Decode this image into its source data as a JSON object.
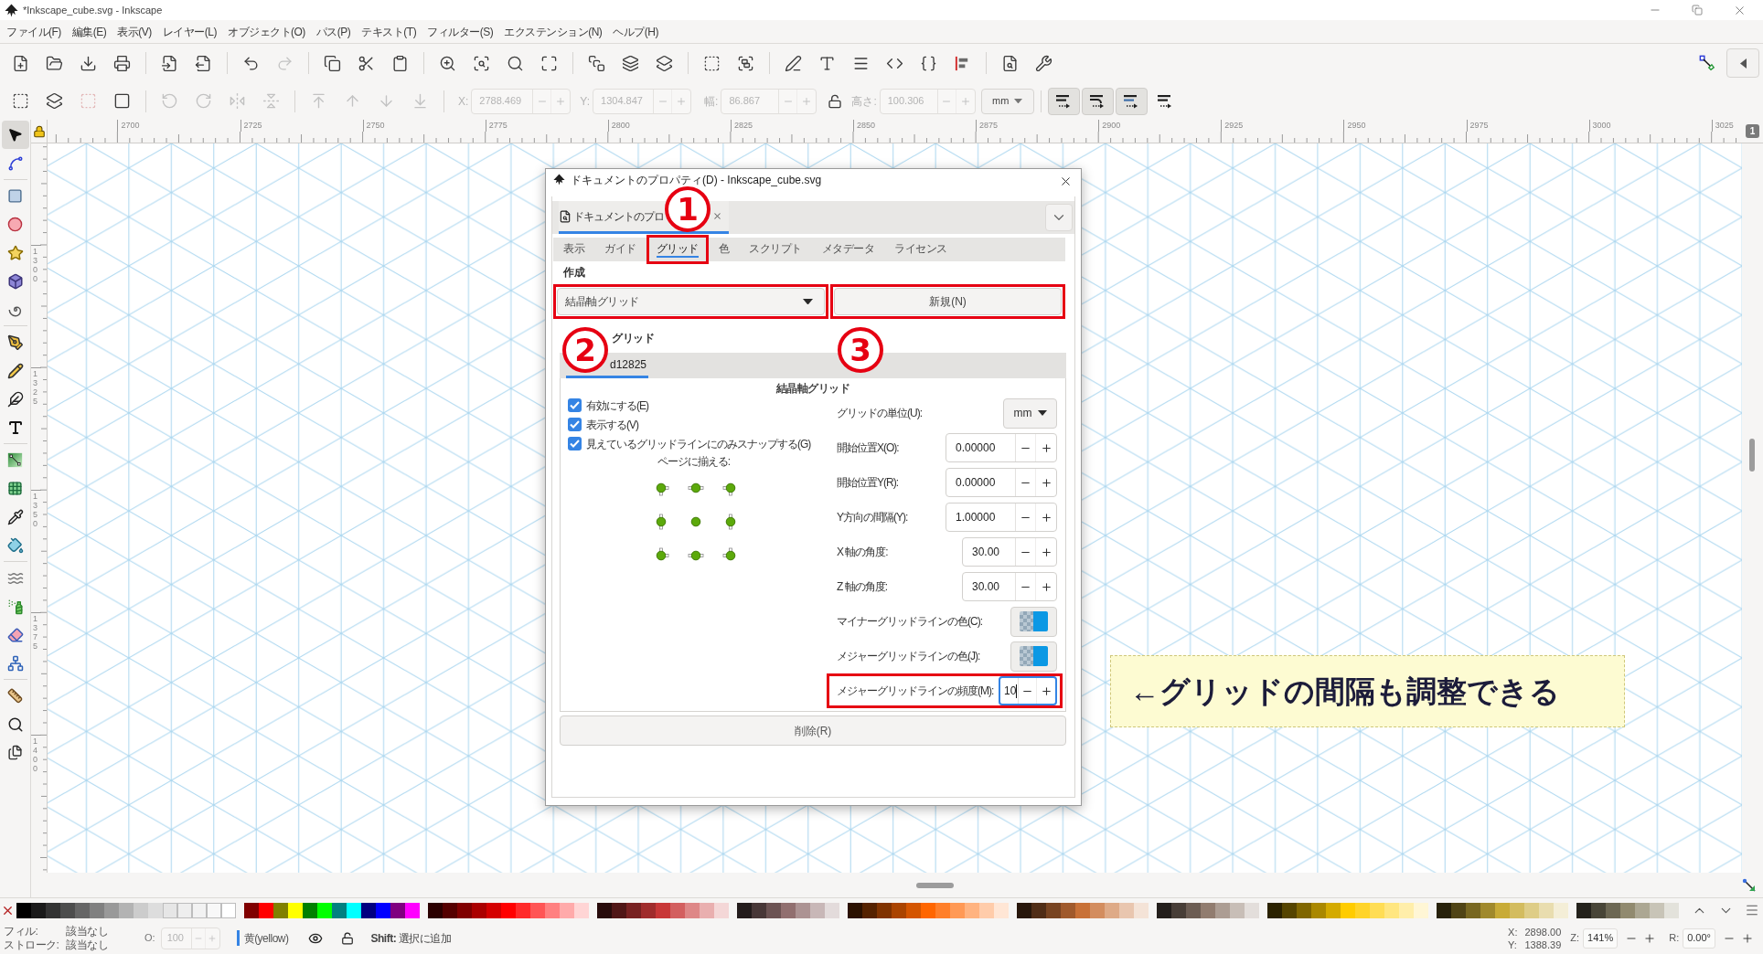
{
  "window": {
    "title": "*Inkscape_cube.svg - Inkscape"
  },
  "menu": [
    "ファイル(F)",
    "編集(E)",
    "表示(V)",
    "レイヤー(L)",
    "オブジェクト(O)",
    "パス(P)",
    "テキスト(T)",
    "フィルター(S)",
    "エクステンション(N)",
    "ヘルプ(H)"
  ],
  "toolbar": {
    "fields": [
      {
        "label": "X:",
        "value": "2788.469",
        "disabled": true
      },
      {
        "label": "Y:",
        "value": "1304.847",
        "disabled": true
      },
      {
        "label": "幅:",
        "value": "86.867",
        "disabled": true
      },
      {
        "label": "高さ:",
        "value": "100.306",
        "disabled": true
      }
    ],
    "unit": "mm",
    "toggles": [
      {
        "on": true
      },
      {
        "on": true
      },
      {
        "on": true
      },
      {
        "on": false
      }
    ]
  },
  "ruler": {
    "horizontal": [
      "2700",
      "2725",
      "2750",
      "2775",
      "2800",
      "2825",
      "2850",
      "2875",
      "2900",
      "2925",
      "2950",
      "2975",
      "3000",
      "3025"
    ],
    "vertical": [
      "1300",
      "1325",
      "1350",
      "1375",
      "1400"
    ],
    "page_badge": "1"
  },
  "tools": [
    {
      "selected": true
    },
    {
      "selected": false
    },
    {
      "selected": false
    },
    {
      "selected": false
    },
    {
      "selected": false
    },
    {
      "selected": false
    },
    {
      "selected": false
    },
    {
      "selected": false
    },
    {
      "selected": false
    },
    {
      "selected": false
    },
    {
      "selected": false
    },
    {
      "selected": false
    },
    {
      "selected": false
    },
    {
      "selected": false
    },
    {
      "selected": false
    },
    {
      "selected": false
    },
    {
      "selected": false
    },
    {
      "selected": false
    },
    {
      "selected": false
    },
    {
      "selected": false
    },
    {
      "selected": false
    },
    {
      "selected": false
    }
  ],
  "dialog": {
    "title": "ドキュメントのプロパティ(D) - Inkscape_cube.svg",
    "dock_tab": {
      "label": "ドキュメントのプロ",
      "selected": true
    },
    "tabs": [
      {
        "label": "表示",
        "selected": false,
        "highlighted": false
      },
      {
        "label": "ガイド",
        "selected": false,
        "highlighted": false
      },
      {
        "label": "グリッド",
        "selected": true,
        "highlighted": true
      },
      {
        "label": "色",
        "selected": false,
        "highlighted": false
      },
      {
        "label": "スクリプト",
        "selected": false,
        "highlighted": false
      },
      {
        "label": "メタデータ",
        "selected": false,
        "highlighted": false
      },
      {
        "label": "ライセンス",
        "selected": false,
        "highlighted": false
      }
    ],
    "create_label": "作成",
    "grid_type": {
      "value": "結晶軸グリッド",
      "highlighted": true
    },
    "new_button": {
      "label": "新規(N)",
      "highlighted": true
    },
    "grids_label": "グリッド",
    "grid_tab": {
      "label": "d12825",
      "selected": true
    },
    "grid_heading": "結晶軸グリッド",
    "checkboxes": [
      {
        "label": "有効にする(E)",
        "checked": true
      },
      {
        "label": "表示する(V)",
        "checked": true
      },
      {
        "label": "見えているグリッドラインにのみスナップする(G)",
        "checked": true
      }
    ],
    "align_label": "ページに揃える:",
    "settings": [
      {
        "kind": "dropdown",
        "label": "グリッドの単位(U):",
        "value": "mm",
        "highlighted": false
      },
      {
        "kind": "spin",
        "label": "開始位置X(O):",
        "value": "0.00000",
        "focused": false,
        "highlighted": false
      },
      {
        "kind": "spin",
        "label": "開始位置Y(R):",
        "value": "0.00000",
        "focused": false,
        "highlighted": false
      },
      {
        "kind": "spin",
        "label": "Y方向の間隔(Y):",
        "value": "1.00000",
        "focused": false,
        "highlighted": false
      },
      {
        "kind": "angle",
        "label": "X 軸の角度:",
        "value": "30.00",
        "focused": false,
        "highlighted": false
      },
      {
        "kind": "angle",
        "label": "Z 軸の角度:",
        "value": "30.00",
        "focused": false,
        "highlighted": false
      },
      {
        "kind": "color",
        "label": "マイナーグリッドラインの色(C):",
        "color": "#0b98e4",
        "highlighted": false
      },
      {
        "kind": "color",
        "label": "メジャーグリッドラインの色(J):",
        "color": "#0b98e4",
        "highlighted": false
      },
      {
        "kind": "count",
        "label": "メジャーグリッドラインの頻度(M):",
        "value": "10",
        "focused": true,
        "highlighted": true
      }
    ],
    "delete_button": "削除(R)"
  },
  "markers": [
    {
      "number": "1"
    },
    {
      "number": "2"
    },
    {
      "number": "3"
    }
  ],
  "callout": {
    "text": "←グリッドの間隔も調整できる"
  },
  "palette_groups": [
    {
      "swatches": [
        {
          "color": "#000000"
        },
        {
          "color": "#1a1a1a"
        },
        {
          "color": "#333333"
        },
        {
          "color": "#4d4d4d"
        },
        {
          "color": "#666666"
        },
        {
          "color": "#808080"
        },
        {
          "color": "#999999"
        },
        {
          "color": "#b3b3b3"
        },
        {
          "color": "#cccccc"
        },
        {
          "color": "#dddddd"
        },
        {
          "color": "#e6e6e6"
        },
        {
          "color": "#eeeeee"
        },
        {
          "color": "#f2f2f2"
        },
        {
          "color": "#f8f8f8"
        },
        {
          "color": "#ffffff"
        }
      ]
    },
    {
      "swatches": [
        {
          "color": "#800000"
        },
        {
          "color": "#ff0000"
        },
        {
          "color": "#808000"
        },
        {
          "color": "#ffff00"
        },
        {
          "color": "#008000"
        },
        {
          "color": "#00ff00"
        },
        {
          "color": "#008080"
        },
        {
          "color": "#00ffff"
        },
        {
          "color": "#000080"
        },
        {
          "color": "#0000ff"
        },
        {
          "color": "#800080"
        },
        {
          "color": "#ff00ff"
        }
      ]
    },
    {
      "swatches": [
        {
          "color": "#2b0000"
        },
        {
          "color": "#550000"
        },
        {
          "color": "#800000"
        },
        {
          "color": "#aa0000"
        },
        {
          "color": "#d40000"
        },
        {
          "color": "#ff0000"
        },
        {
          "color": "#ff2a2a"
        },
        {
          "color": "#ff5555"
        },
        {
          "color": "#ff8080"
        },
        {
          "color": "#ffaaaa"
        },
        {
          "color": "#ffd5d5"
        }
      ]
    },
    {
      "swatches": [
        {
          "color": "#280b0b"
        },
        {
          "color": "#501616"
        },
        {
          "color": "#782121"
        },
        {
          "color": "#a02c2c"
        },
        {
          "color": "#c83737"
        },
        {
          "color": "#d35f5f"
        },
        {
          "color": "#de8787"
        },
        {
          "color": "#e9afaf"
        },
        {
          "color": "#f4d7d7"
        }
      ]
    },
    {
      "swatches": [
        {
          "color": "#241c1c"
        },
        {
          "color": "#483737"
        },
        {
          "color": "#6c5353"
        },
        {
          "color": "#916f6f"
        },
        {
          "color": "#ac9393"
        },
        {
          "color": "#c8b7b7"
        },
        {
          "color": "#e3dbdb"
        }
      ]
    },
    {
      "swatches": [
        {
          "color": "#2b1100"
        },
        {
          "color": "#552200"
        },
        {
          "color": "#803300"
        },
        {
          "color": "#aa4400"
        },
        {
          "color": "#d45500"
        },
        {
          "color": "#ff6600"
        },
        {
          "color": "#ff7f2a"
        },
        {
          "color": "#ff9955"
        },
        {
          "color": "#ffb380"
        },
        {
          "color": "#ffccaa"
        },
        {
          "color": "#ffe6d5"
        }
      ]
    },
    {
      "swatches": [
        {
          "color": "#28170b"
        },
        {
          "color": "#502d16"
        },
        {
          "color": "#784421"
        },
        {
          "color": "#a05a2c"
        },
        {
          "color": "#c87137"
        },
        {
          "color": "#d38d5f"
        },
        {
          "color": "#deaa87"
        },
        {
          "color": "#e9c6af"
        },
        {
          "color": "#f4e3d7"
        }
      ]
    },
    {
      "swatches": [
        {
          "color": "#241f1c"
        },
        {
          "color": "#483e37"
        },
        {
          "color": "#6c5d53"
        },
        {
          "color": "#917c6f"
        },
        {
          "color": "#ac9d93"
        },
        {
          "color": "#c8beb7"
        },
        {
          "color": "#e3dedb"
        }
      ]
    },
    {
      "swatches": [
        {
          "color": "#2b2200"
        },
        {
          "color": "#554400"
        },
        {
          "color": "#806600"
        },
        {
          "color": "#aa8800"
        },
        {
          "color": "#d4aa00"
        },
        {
          "color": "#ffcc00"
        },
        {
          "color": "#ffd42a"
        },
        {
          "color": "#ffdd55"
        },
        {
          "color": "#ffe680"
        },
        {
          "color": "#ffeeaa"
        },
        {
          "color": "#fff6d5"
        }
      ]
    },
    {
      "swatches": [
        {
          "color": "#28220b"
        },
        {
          "color": "#504416"
        },
        {
          "color": "#786721"
        },
        {
          "color": "#a0892c"
        },
        {
          "color": "#c8ab37"
        },
        {
          "color": "#d3bc5f"
        },
        {
          "color": "#decd87"
        },
        {
          "color": "#e9ddaf"
        },
        {
          "color": "#f4eed7"
        }
      ]
    },
    {
      "swatches": [
        {
          "color": "#24221c"
        },
        {
          "color": "#484537"
        },
        {
          "color": "#6c6753"
        },
        {
          "color": "#918a6f"
        },
        {
          "color": "#aca793"
        },
        {
          "color": "#c8c4b7"
        },
        {
          "color": "#e3e2db"
        }
      ]
    }
  ],
  "status_bar": {
    "fill_label": "フィル:",
    "fill_value": "該当なし",
    "stroke_label": "ストローク:",
    "stroke_value": "該当なし",
    "opacity_label": "O:",
    "opacity_value": "100",
    "layer": "黄(yellow)",
    "message": "**Shift:** 選択に追加",
    "x_label": "X:",
    "x_value": "2898.00",
    "y_label": "Y:",
    "y_value": "1388.39",
    "zoom_label": "Z:",
    "zoom_value": "141%",
    "rotation_label": "R:",
    "rotation_value": "0.00°"
  }
}
